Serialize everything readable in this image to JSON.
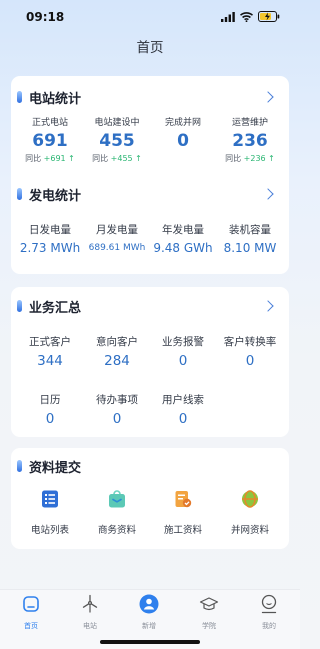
{
  "status_bar": {
    "time": "09:18"
  },
  "header": {
    "title": "首页"
  },
  "station_stats": {
    "title": "电站统计",
    "items": [
      {
        "label": "正式电站",
        "value": "691",
        "yoy_label": "同比",
        "yoy_value": "+691"
      },
      {
        "label": "电站建设中",
        "value": "455",
        "yoy_label": "同比",
        "yoy_value": "+455"
      },
      {
        "label": "完成并网",
        "value": "0"
      },
      {
        "label": "运营维护",
        "value": "236",
        "yoy_label": "同比",
        "yoy_value": "+236"
      }
    ]
  },
  "power_stats": {
    "title": "发电统计",
    "items": [
      {
        "label": "日发电量",
        "value": "2.73 MWh"
      },
      {
        "label": "月发电量",
        "value": "689.61 MWh"
      },
      {
        "label": "年发电量",
        "value": "9.48 GWh"
      },
      {
        "label": "装机容量",
        "value": "8.10 MW"
      }
    ]
  },
  "business": {
    "title": "业务汇总",
    "row1": [
      {
        "label": "正式客户",
        "value": "344"
      },
      {
        "label": "意向客户",
        "value": "284"
      },
      {
        "label": "业务报警",
        "value": "0"
      },
      {
        "label": "客户转换率",
        "value": "0"
      }
    ],
    "row2": [
      {
        "label": "日历",
        "value": "0"
      },
      {
        "label": "待办事项",
        "value": "0"
      },
      {
        "label": "用户线索",
        "value": "0"
      }
    ]
  },
  "submission": {
    "title": "资料提交",
    "items": [
      {
        "label": "电站列表",
        "icon": "list-icon"
      },
      {
        "label": "商务资料",
        "icon": "bag-icon"
      },
      {
        "label": "施工资料",
        "icon": "checklist-icon"
      },
      {
        "label": "并网资料",
        "icon": "grid-globe-icon"
      }
    ]
  },
  "tabbar": {
    "tabs": [
      {
        "label": "首页",
        "icon": "home-icon",
        "active": true
      },
      {
        "label": "电站",
        "icon": "wind-turbine-icon"
      },
      {
        "label": "新增",
        "icon": "add-user-icon"
      },
      {
        "label": "学院",
        "icon": "graduation-cap-icon"
      },
      {
        "label": "我的",
        "icon": "profile-icon"
      }
    ]
  },
  "colors": {
    "accent": "#2f80ed",
    "value": "#2e6fc4",
    "up": "#2bb673"
  }
}
